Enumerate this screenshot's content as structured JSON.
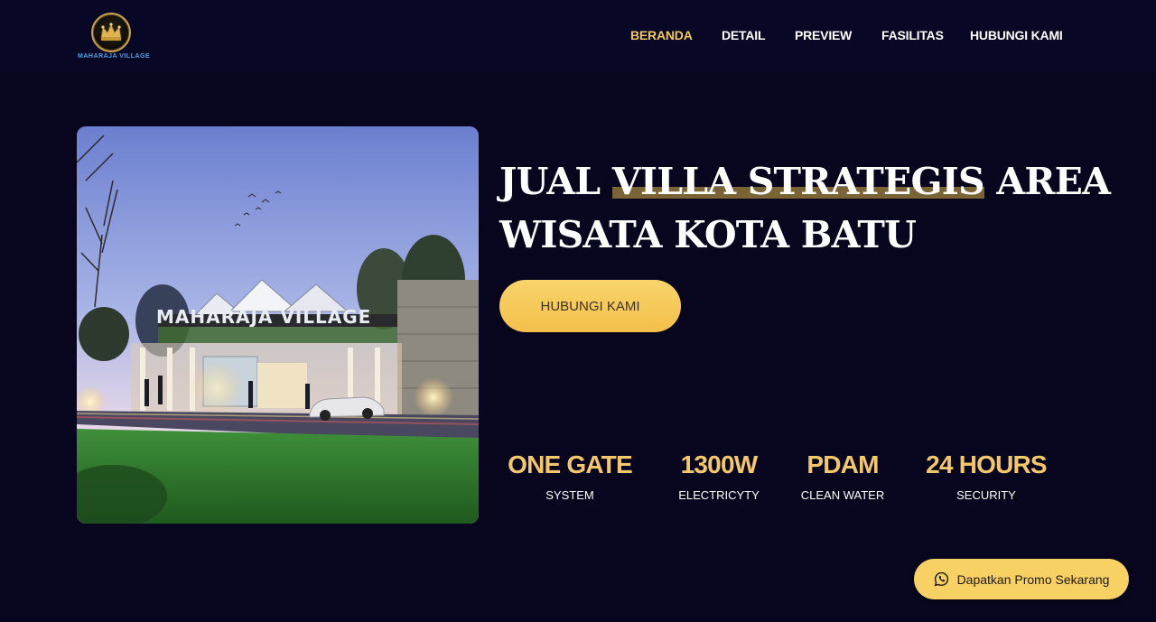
{
  "brand": {
    "logo_text": "MAHARAJA VILLAGE",
    "gold": "#c9a24a",
    "accent": "#f3c95f",
    "background": "#08061f"
  },
  "nav": {
    "items": [
      {
        "label": "BERANDA",
        "active": true
      },
      {
        "label": "DETAIL",
        "active": false
      },
      {
        "label": "PREVIEW",
        "active": false
      },
      {
        "label": "FASILITAS",
        "active": false
      },
      {
        "label": "HUBUNGI KAMI",
        "active": false
      }
    ]
  },
  "hero": {
    "image_sign_text": "MAHARAJA VILLAGE",
    "heading_part1": "JUAL ",
    "heading_highlight": "VILLA STRATEGIS",
    "heading_part2": " AREA WISATA KOTA BATU",
    "cta_label": "HUBUNGI KAMI"
  },
  "features": [
    {
      "value": "ONE GATE",
      "label": "SYSTEM"
    },
    {
      "value": "1300W",
      "label": "ELECTRICYTY"
    },
    {
      "value": "PDAM",
      "label": "CLEAN WATER"
    },
    {
      "value": "24 HOURS",
      "label": "SECURITY"
    }
  ],
  "promo": {
    "label": "Dapatkan Promo Sekarang",
    "icon": "whatsapp-icon"
  }
}
